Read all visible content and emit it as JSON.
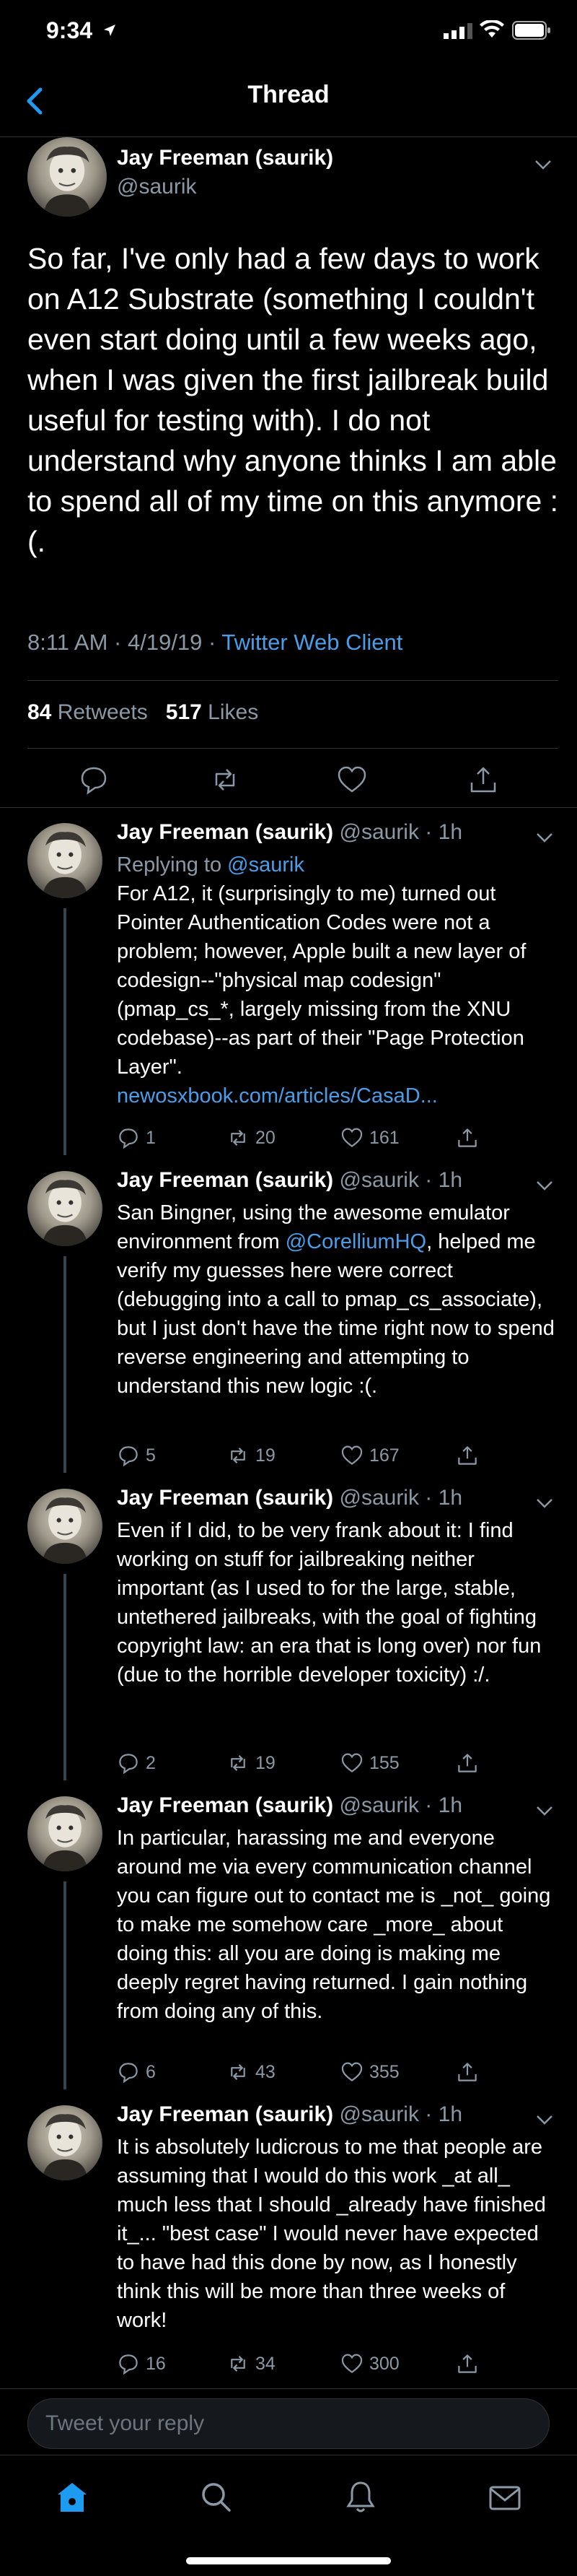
{
  "status_bar": {
    "time": "9:34",
    "location_icon": "location-arrow-icon",
    "signal_icon": "cellular-signal-icon",
    "wifi_icon": "wifi-icon",
    "battery_icon": "battery-icon"
  },
  "nav": {
    "title": "Thread",
    "back_icon": "chevron-left-icon"
  },
  "main_tweet": {
    "name": "Jay Freeman (saurik)",
    "handle": "@saurik",
    "text": "So far, I've only had a few days to work on A12 Substrate (something I couldn't even start doing until a few weeks ago, when I was given the first jailbreak build useful for testing with). I do not understand why anyone thinks I am able to spend all of my time on this anymore :(.",
    "timestamp": "8:11 AM · 4/19/19 · ",
    "client": "Twitter Web Client",
    "retweets_count": "84",
    "retweets_label": " Retweets",
    "likes_count": "517",
    "likes_label": " Likes"
  },
  "replies": [
    {
      "name": "Jay Freeman (saurik)",
      "meta": " @saurik · 1h",
      "replying_label": "Replying to ",
      "replying_handle": "@saurik",
      "text": "For A12, it (surprisingly to me) turned out Pointer Authentication Codes were not a problem; however, Apple built a new layer of codesign--\"physical map codesign\" (pmap_cs_*, largely missing from the XNU codebase)--as part of their \"Page Protection Layer\".",
      "link": "newosxbook.com/articles/CasaD...",
      "replies": "1",
      "retweets": "20",
      "likes": "161"
    },
    {
      "name": "Jay Freeman (saurik)",
      "meta": " @saurik · 1h",
      "text_before": "San Bingner, using the awesome emulator environment from ",
      "mention": "@CorelliumHQ",
      "text_after": ", helped me verify my guesses here were correct (debugging into a call to pmap_cs_associate), but I just don't have the time right now to spend reverse engineering and attempting to understand this new logic :(.",
      "replies": "5",
      "retweets": "19",
      "likes": "167"
    },
    {
      "name": "Jay Freeman (saurik)",
      "meta": " @saurik · 1h",
      "text": "Even if I did, to be very frank about it: I find working on stuff for jailbreaking neither important (as I used to for the large, stable, untethered jailbreaks, with the goal of fighting copyright law: an era that is long over) nor fun (due to the horrible developer toxicity) :/.",
      "replies": "2",
      "retweets": "19",
      "likes": "155"
    },
    {
      "name": "Jay Freeman (saurik)",
      "meta": " @saurik · 1h",
      "text": "In particular, harassing me and everyone around me via every communication channel you can figure out to contact me is _not_ going to make me somehow care _more_ about doing this: all you are doing is making me deeply regret having returned. I gain nothing from doing any of this.",
      "replies": "6",
      "retweets": "43",
      "likes": "355"
    },
    {
      "name": "Jay Freeman (saurik)",
      "meta": " @saurik · 1h",
      "text": "It is absolutely ludicrous to me that people are assuming that I would do this work _at all_ much less that I should _already have finished it_... \"best case\" I would never have expected to have had this done by now, as I honestly think this will be more than three weeks of work!",
      "replies": "16",
      "retweets": "34",
      "likes": "300"
    }
  ],
  "composer": {
    "placeholder": "Tweet your reply"
  },
  "tab_bar": {
    "items": [
      "home-icon",
      "search-icon",
      "notifications-bell-icon",
      "messages-envelope-icon"
    ],
    "active_color": "#1d9bf0"
  },
  "colors": {
    "accent": "#1d9bf0",
    "link": "#4a9ee8",
    "muted": "#8b98a5",
    "background": "#000000"
  }
}
